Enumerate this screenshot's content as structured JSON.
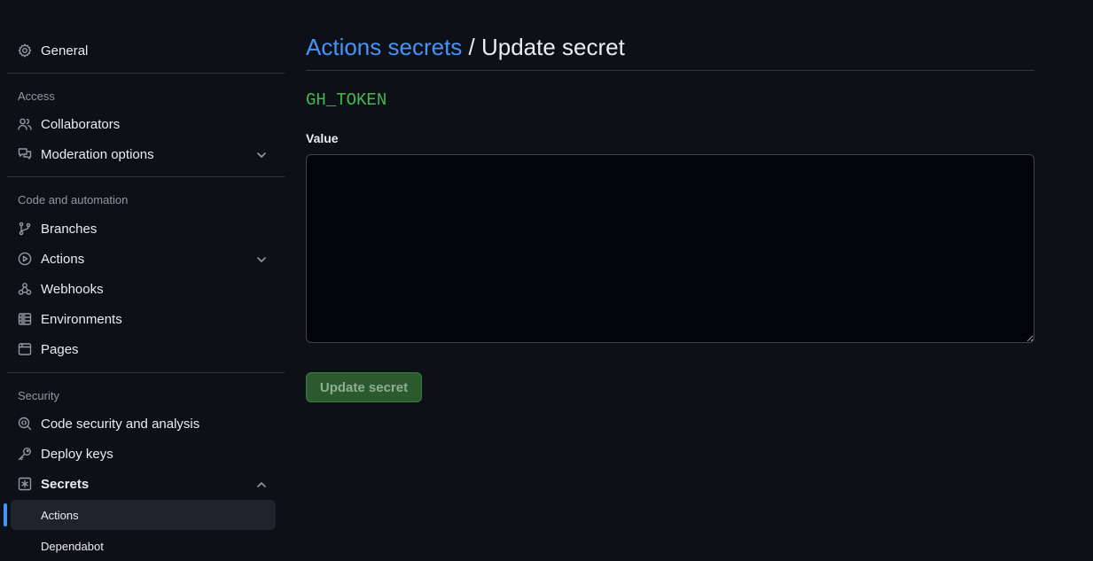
{
  "sidebar": {
    "general": "General",
    "sections": {
      "access": "Access",
      "code_automation": "Code and automation",
      "security": "Security"
    },
    "items": {
      "collaborators": "Collaborators",
      "moderation": "Moderation options",
      "branches": "Branches",
      "actions": "Actions",
      "webhooks": "Webhooks",
      "environments": "Environments",
      "pages": "Pages",
      "code_security": "Code security and analysis",
      "deploy_keys": "Deploy keys",
      "secrets": "Secrets"
    },
    "secrets_sub": {
      "actions": "Actions",
      "dependabot": "Dependabot"
    }
  },
  "main": {
    "breadcrumb_link": "Actions secrets",
    "breadcrumb_sep": " / ",
    "title": "Update secret",
    "secret_name": "GH_TOKEN",
    "value_label": "Value",
    "value": "",
    "submit_label": "Update secret"
  },
  "colors": {
    "background": "#0d1117",
    "link": "#4493f8",
    "secret_name": "#3fb950",
    "button_bg": "#2b5a2f",
    "active_indicator": "#4493f8"
  }
}
